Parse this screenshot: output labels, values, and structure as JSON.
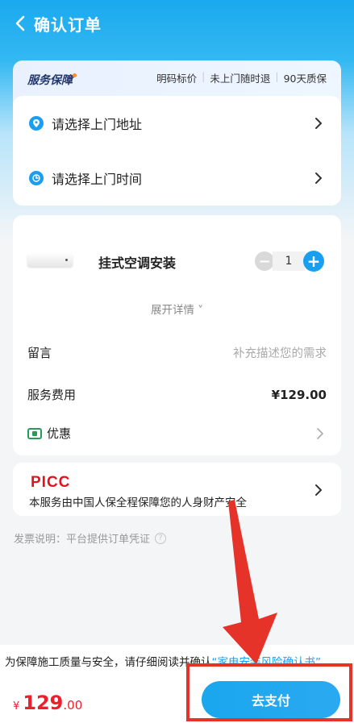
{
  "header": {
    "title": "确认订单"
  },
  "guarantee": {
    "title": "服务保障",
    "tags": [
      "明码标价",
      "未上门随时退",
      "90天质保"
    ]
  },
  "address": {
    "address_label": "请选择上门地址",
    "time_label": "请选择上门时间"
  },
  "service": {
    "name": "挂式空调安装",
    "quantity": "1",
    "minus": "−",
    "plus": "+",
    "expand_label": "展开详情 ˅",
    "message_label": "留言",
    "message_placeholder": "补充描述您的需求",
    "fee_label": "服务费用",
    "fee_value": "¥129.00",
    "coupon_label": "优惠"
  },
  "picc": {
    "logo": "PICC",
    "text": "本服务由中国人保全程保障您的人身财产安全"
  },
  "invoice": {
    "text": "发票说明：平台提供订单凭证",
    "help": "?"
  },
  "bottom": {
    "notice_prefix": "为保障施工质量与安全，请仔细阅读并确认",
    "notice_link": "“家电安装风险确认书”",
    "total_currency": "¥",
    "total_int": "129",
    "total_dec": ".00",
    "pay_label": "去支付"
  },
  "colors": {
    "brand": "#1a9ff0",
    "price": "#ee1f2c",
    "annotation": "#e5332a"
  }
}
